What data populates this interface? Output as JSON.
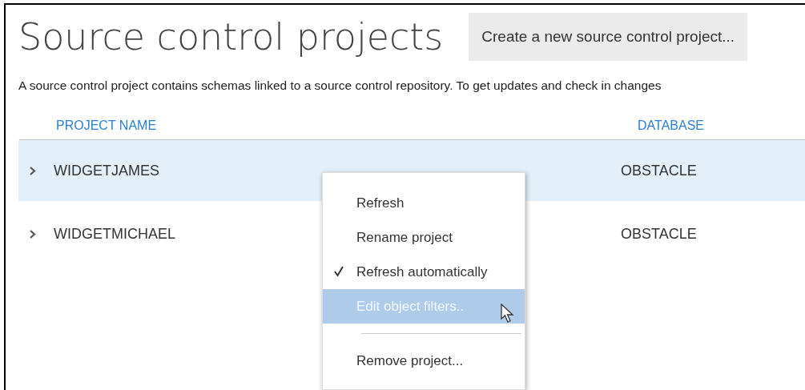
{
  "title": "Source control projects",
  "create_button": "Create a new source control project...",
  "description": "A source control project contains schemas linked to a source control repository. To get updates and check in changes",
  "table": {
    "columns": [
      "PROJECT NAME",
      "DATABASE"
    ],
    "rows": [
      {
        "name": "WIDGETJAMES",
        "database": "OBSTACLE",
        "selected": true
      },
      {
        "name": "WIDGETMICHAEL",
        "database": "OBSTACLE",
        "selected": false
      }
    ]
  },
  "context_menu": [
    {
      "kind": "item",
      "label": "Refresh",
      "checked": false,
      "selected": false
    },
    {
      "kind": "item",
      "label": "Rename project",
      "checked": false,
      "selected": false
    },
    {
      "kind": "item",
      "label": "Refresh automatically",
      "checked": true,
      "selected": false
    },
    {
      "kind": "item",
      "label": "Edit object filters..",
      "checked": false,
      "selected": true
    },
    {
      "kind": "separator"
    },
    {
      "kind": "item",
      "label": "Remove project...",
      "checked": false,
      "selected": false
    }
  ]
}
